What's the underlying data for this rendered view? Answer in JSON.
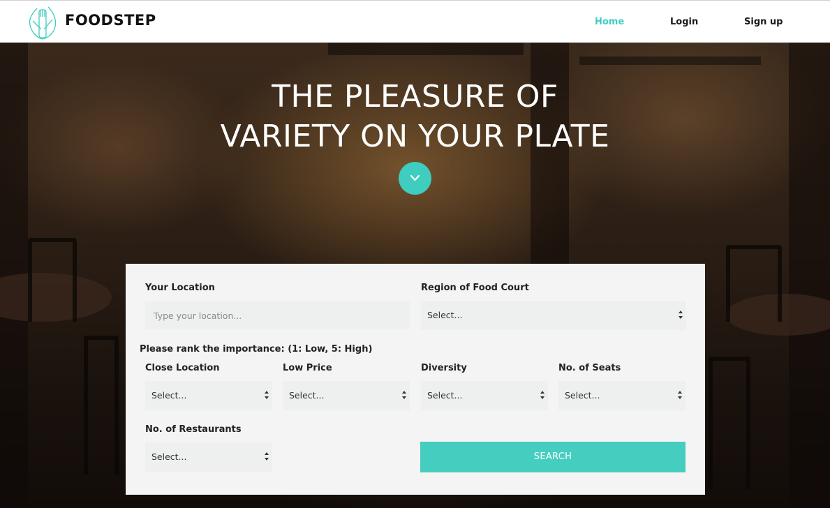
{
  "navbar": {
    "brand": "FOODSTEP",
    "links": [
      {
        "label": "Home",
        "active": true
      },
      {
        "label": "Login",
        "active": false
      },
      {
        "label": "Sign up",
        "active": false
      }
    ]
  },
  "hero": {
    "title_line1": "THE PLEASURE OF",
    "title_line2": "VARIETY ON YOUR PLATE",
    "scroll_icon": "chevron-down-icon"
  },
  "search_form": {
    "location_label": "Your Location",
    "location_placeholder": "Type your location...",
    "region_label": "Region of Food Court",
    "region_value": "Select...",
    "rank_prompt": "Please rank the importance: (1: Low, 5: High)",
    "criteria": [
      {
        "label": "Close Location",
        "value": "Select..."
      },
      {
        "label": "Low Price",
        "value": "Select..."
      },
      {
        "label": "Diversity",
        "value": "Select..."
      },
      {
        "label": "No. of Seats",
        "value": "Select..."
      },
      {
        "label": "No. of Restaurants",
        "value": "Select..."
      }
    ],
    "search_label": "SEARCH"
  },
  "colors": {
    "accent": "#3fcdbf",
    "panel_bg": "#f3f4f3",
    "input_bg": "#eef0ef"
  }
}
